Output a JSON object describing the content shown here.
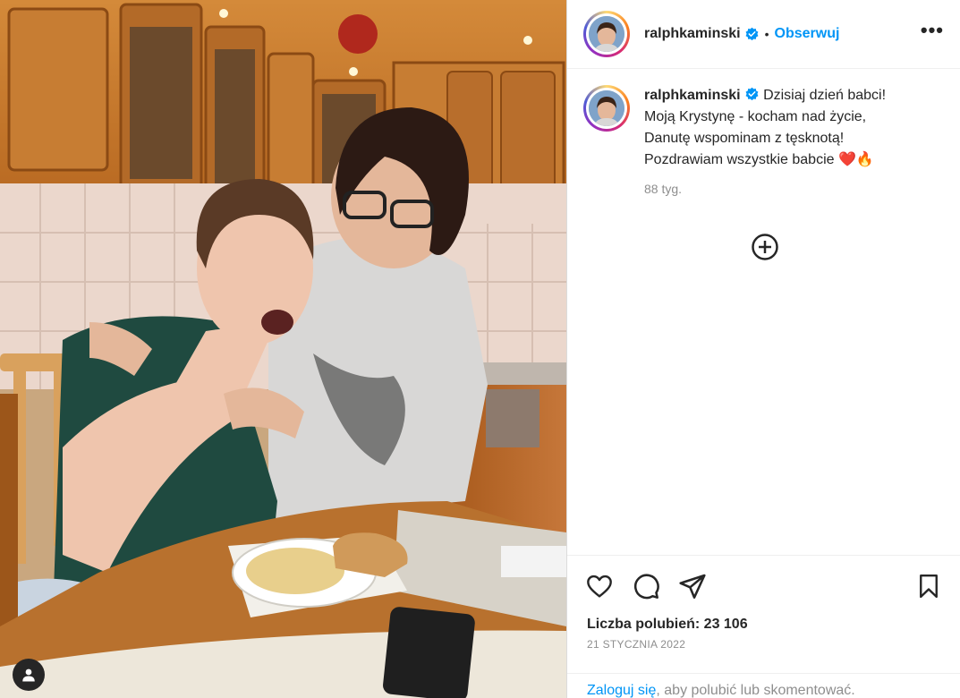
{
  "post": {
    "username": "ralphkaminski",
    "follow_label": "Obserwuj",
    "separator": "•",
    "more_label": "•••",
    "caption_username": "ralphkaminski",
    "caption_lines": [
      "Dzisiaj dzień babci!",
      "Moją Krystynę - kocham nad życie,",
      "Danutę wspominam z tęsknotą!",
      "Pozdrawiam wszystkie babcie ❤️🔥"
    ],
    "time_ago": "88 tyg.",
    "likes": "Liczba polubień: 23 106",
    "date": "21 STYCZNIA 2022",
    "login_link": "Zaloguj się",
    "login_rest": ", aby polubić lub skomentować."
  },
  "icons": [
    "verified-icon",
    "more-options-icon",
    "load-more-icon",
    "like-icon",
    "comment-icon",
    "share-icon",
    "save-icon",
    "tagged-user-icon"
  ],
  "colors": {
    "accent": "#0095f6",
    "text": "#262626",
    "muted": "#8e8e8e",
    "border": "#efefef"
  }
}
